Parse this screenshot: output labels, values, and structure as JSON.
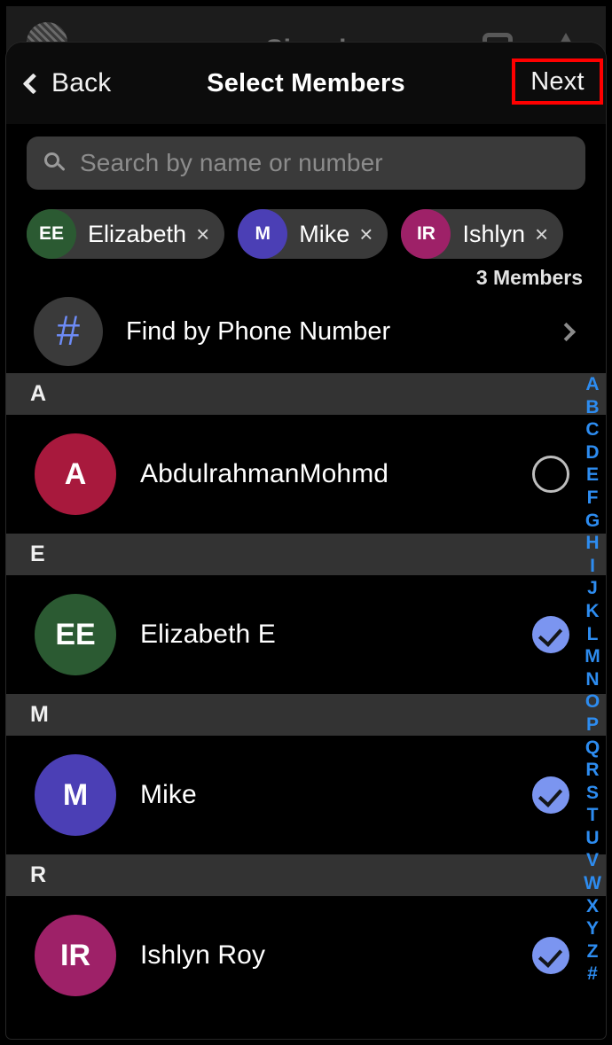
{
  "background_app": {
    "title": "Signal",
    "avatar_icon": "profile-avatar-icon",
    "camera_icon": "camera-icon",
    "compose_icon": "compose-icon"
  },
  "navbar": {
    "back_label": "Back",
    "back_icon": "chevron-left-icon",
    "title": "Select Members",
    "next_label": "Next",
    "highlight_color": "#ff0000"
  },
  "search": {
    "icon": "search-icon",
    "placeholder": "Search by name or number",
    "value": ""
  },
  "selected_chips": [
    {
      "initials": "EE",
      "name": "Elizabeth",
      "color": "#2b5a32",
      "remove_icon": "×"
    },
    {
      "initials": "M",
      "name": "Mike",
      "color": "#4b3fb5",
      "remove_icon": "×"
    },
    {
      "initials": "IR",
      "name": "Ishlyn",
      "color": "#9e2168",
      "remove_icon": "×"
    }
  ],
  "members_count_label": "3 Members",
  "find_by_phone": {
    "icon": "hash-icon",
    "glyph": "#",
    "label": "Find by Phone Number",
    "chevron_icon": "chevron-right-icon"
  },
  "sections": [
    {
      "letter": "A",
      "contacts": [
        {
          "initials": "A",
          "name": "AbdulrahmanMohmd",
          "color": "#a8193d",
          "selected": false
        }
      ]
    },
    {
      "letter": "E",
      "contacts": [
        {
          "initials": "EE",
          "name": "Elizabeth E",
          "color": "#2b5a32",
          "selected": true
        }
      ]
    },
    {
      "letter": "M",
      "contacts": [
        {
          "initials": "M",
          "name": "Mike",
          "color": "#4b3fb5",
          "selected": true
        }
      ]
    },
    {
      "letter": "R",
      "contacts": [
        {
          "initials": "IR",
          "name": "Ishlyn Roy",
          "color": "#9e2168",
          "selected": true
        }
      ]
    }
  ],
  "alphabet_index": {
    "color": "#2d8cf0",
    "letters": [
      "A",
      "B",
      "C",
      "D",
      "E",
      "F",
      "G",
      "H",
      "I",
      "J",
      "K",
      "L",
      "M",
      "N",
      "O",
      "P",
      "Q",
      "R",
      "S",
      "T",
      "U",
      "V",
      "W",
      "X",
      "Y",
      "Z",
      "#"
    ]
  }
}
